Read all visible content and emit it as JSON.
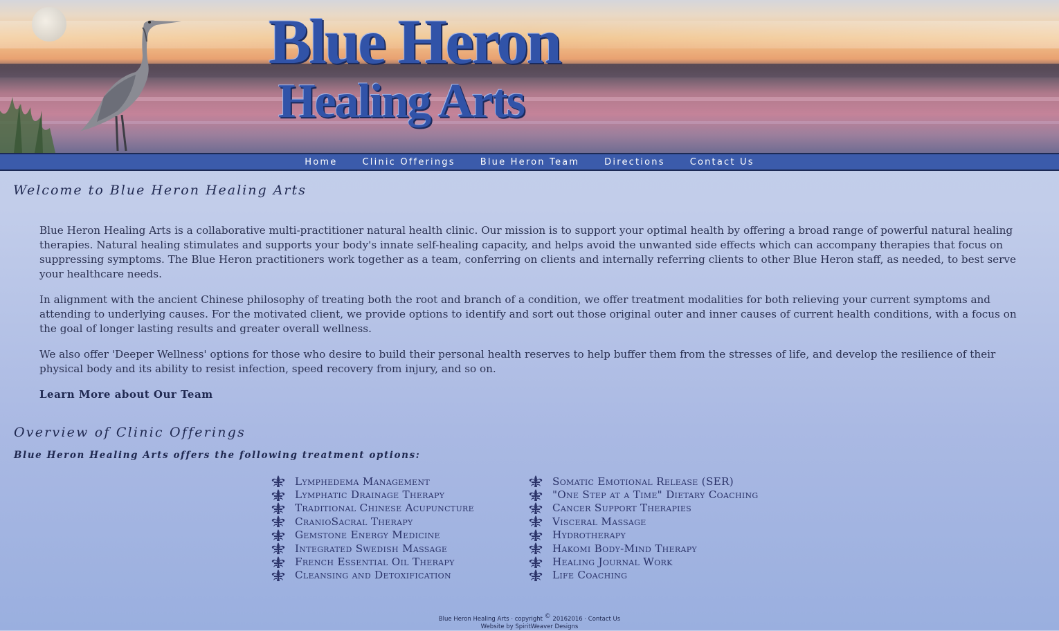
{
  "banner": {
    "logo_line1": "Blue Heron",
    "logo_line2": "Healing Arts"
  },
  "nav": {
    "items": [
      "Home",
      "Clinic Offerings",
      "Blue Heron Team",
      "Directions",
      "Contact Us"
    ]
  },
  "welcome": {
    "title": "Welcome to Blue Heron Healing Arts",
    "paragraphs": [
      "Blue Heron Healing Arts is a collaborative multi-practitioner natural health clinic. Our mission is to support your optimal health by offering a broad range of powerful natural healing therapies. Natural healing stimulates and supports your body's innate self-healing capacity, and helps avoid the unwanted side effects which can accompany therapies that focus on suppressing symptoms. The Blue Heron practitioners work together as a team, conferring on clients and internally referring clients to other Blue Heron staff, as needed, to best serve your healthcare needs.",
      "In alignment with the ancient Chinese philosophy of treating both the root and branch of a condition, we offer treatment modalities for both relieving your current symptoms and attending to underlying causes. For the motivated client, we provide options to identify and sort out those original outer and inner causes of current health conditions, with a focus on the goal of longer lasting results and greater overall wellness.",
      "We also offer 'Deeper Wellness' options for those who desire to build their personal health reserves to help buffer them from the stresses of life, and develop the resilience of their physical body and its ability to resist infection, speed recovery from injury, and so on."
    ],
    "learn_more": "Learn More about Our Team"
  },
  "overview": {
    "title": "Overview of Clinic Offerings",
    "subtitle": "Blue Heron Healing Arts offers the following treatment options:",
    "column1": [
      "Lymphedema Management",
      "Lymphatic Drainage Therapy",
      "Traditional Chinese Acupuncture",
      "CranioSacral Therapy",
      "Gemstone Energy Medicine",
      "Integrated Swedish Massage",
      "French Essential Oil Therapy",
      "Cleansing and Detoxification"
    ],
    "column2": [
      "Somatic Emotional Release (SER)",
      "\"One Step at a Time\" Dietary Coaching",
      "Cancer Support Therapies",
      "Visceral Massage",
      "Hydrotherapy",
      "Hakomi Body-Mind Therapy",
      "Healing Journal Work",
      "Life Coaching"
    ],
    "bullet_icon": "fleur-de-lis-icon"
  },
  "footer": {
    "site_name": "Blue Heron Healing Arts",
    "sep": "·",
    "copyright_word": "copyright",
    "copyright_symbol": "©",
    "years": "20162016",
    "contact": "Contact Us",
    "credit": "Website by SpiritWeaver Designs"
  },
  "colors": {
    "nav_bg": "#3b5bab",
    "text": "#28304e",
    "logo_blue": "#3153a8"
  }
}
